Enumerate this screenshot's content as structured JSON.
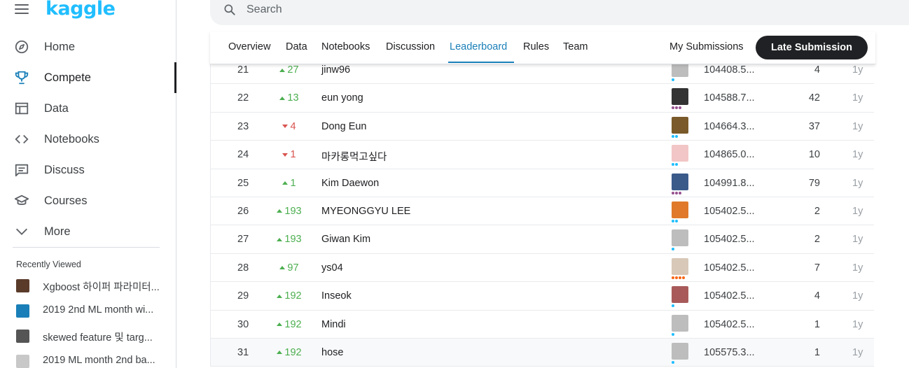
{
  "brand": {
    "logo": "kaggle",
    "accent": "#20beff"
  },
  "sidebar": {
    "items": [
      {
        "label": "Home",
        "icon": "compass-icon"
      },
      {
        "label": "Compete",
        "icon": "trophy-icon",
        "active": true
      },
      {
        "label": "Data",
        "icon": "table-icon"
      },
      {
        "label": "Notebooks",
        "icon": "code-icon"
      },
      {
        "label": "Discuss",
        "icon": "comment-icon"
      },
      {
        "label": "Courses",
        "icon": "school-icon"
      },
      {
        "label": "More",
        "icon": "chevron-down-icon"
      }
    ],
    "recent_title": "Recently Viewed",
    "recent": [
      {
        "label": "Xgboost 하이퍼 파라미터...",
        "thumb_color": "#5a3b2a"
      },
      {
        "label": "2019 2nd ML month wi...",
        "thumb_color": "#1a7fb8"
      },
      {
        "label": "skewed feature 및 targ...",
        "thumb_color": "#555555"
      },
      {
        "label": "2019 ML month 2nd ba...",
        "thumb_color": "#c8c8c8"
      }
    ]
  },
  "search": {
    "placeholder": "Search"
  },
  "tabs": {
    "items": [
      "Overview",
      "Data",
      "Notebooks",
      "Discussion",
      "Leaderboard",
      "Rules",
      "Team"
    ],
    "active": "Leaderboard",
    "my_submissions": "My Submissions",
    "late_submission": "Late Submission"
  },
  "leaderboard": {
    "rows": [
      {
        "rank": "21",
        "dir": "up",
        "delta": "27",
        "team": "jinw96",
        "score": "104408.5...",
        "entries": "4",
        "last": "1y",
        "avatar": "#bdbdbd",
        "tier": [
          "#20beff"
        ]
      },
      {
        "rank": "22",
        "dir": "up",
        "delta": "13",
        "team": "eun yong",
        "score": "104588.7...",
        "entries": "42",
        "last": "1y",
        "avatar": "#333333",
        "tier": [
          "#96508e",
          "#96508e",
          "#96508e"
        ]
      },
      {
        "rank": "23",
        "dir": "down",
        "delta": "4",
        "team": "Dong Eun",
        "score": "104664.3...",
        "entries": "37",
        "last": "1y",
        "avatar": "#7a5a2a",
        "tier": [
          "#20beff",
          "#20beff"
        ]
      },
      {
        "rank": "24",
        "dir": "down",
        "delta": "1",
        "team": "마카롱먹고싶다",
        "score": "104865.0...",
        "entries": "10",
        "last": "1y",
        "avatar": "#f2c6c6",
        "tier": [
          "#20beff",
          "#20beff"
        ]
      },
      {
        "rank": "25",
        "dir": "up",
        "delta": "1",
        "team": "Kim Daewon",
        "score": "104991.8...",
        "entries": "79",
        "last": "1y",
        "avatar": "#3a5a8a",
        "tier": [
          "#96508e",
          "#96508e",
          "#96508e"
        ]
      },
      {
        "rank": "26",
        "dir": "up",
        "delta": "193",
        "team": "MYEONGGYU LEE",
        "score": "105402.5...",
        "entries": "2",
        "last": "1y",
        "avatar": "#e07a2a",
        "tier": [
          "#20beff",
          "#20beff"
        ]
      },
      {
        "rank": "27",
        "dir": "up",
        "delta": "193",
        "team": "Giwan Kim",
        "score": "105402.5...",
        "entries": "2",
        "last": "1y",
        "avatar": "#bdbdbd",
        "tier": [
          "#20beff"
        ]
      },
      {
        "rank": "28",
        "dir": "up",
        "delta": "97",
        "team": "ys04",
        "score": "105402.5...",
        "entries": "7",
        "last": "1y",
        "avatar": "#d8c8b8",
        "tier": [
          "#f96517",
          "#f96517",
          "#f96517",
          "#f96517"
        ]
      },
      {
        "rank": "29",
        "dir": "up",
        "delta": "192",
        "team": "Inseok",
        "score": "105402.5...",
        "entries": "4",
        "last": "1y",
        "avatar": "#a85a5a",
        "tier": [
          "#20beff"
        ]
      },
      {
        "rank": "30",
        "dir": "up",
        "delta": "192",
        "team": "Mindi",
        "score": "105402.5...",
        "entries": "1",
        "last": "1y",
        "avatar": "#bdbdbd",
        "tier": [
          "#20beff"
        ]
      },
      {
        "rank": "31",
        "dir": "up",
        "delta": "192",
        "team": "hose",
        "score": "105575.3...",
        "entries": "1",
        "last": "1y",
        "avatar": "#bdbdbd",
        "tier": [
          "#20beff"
        ],
        "hover": true
      }
    ]
  }
}
